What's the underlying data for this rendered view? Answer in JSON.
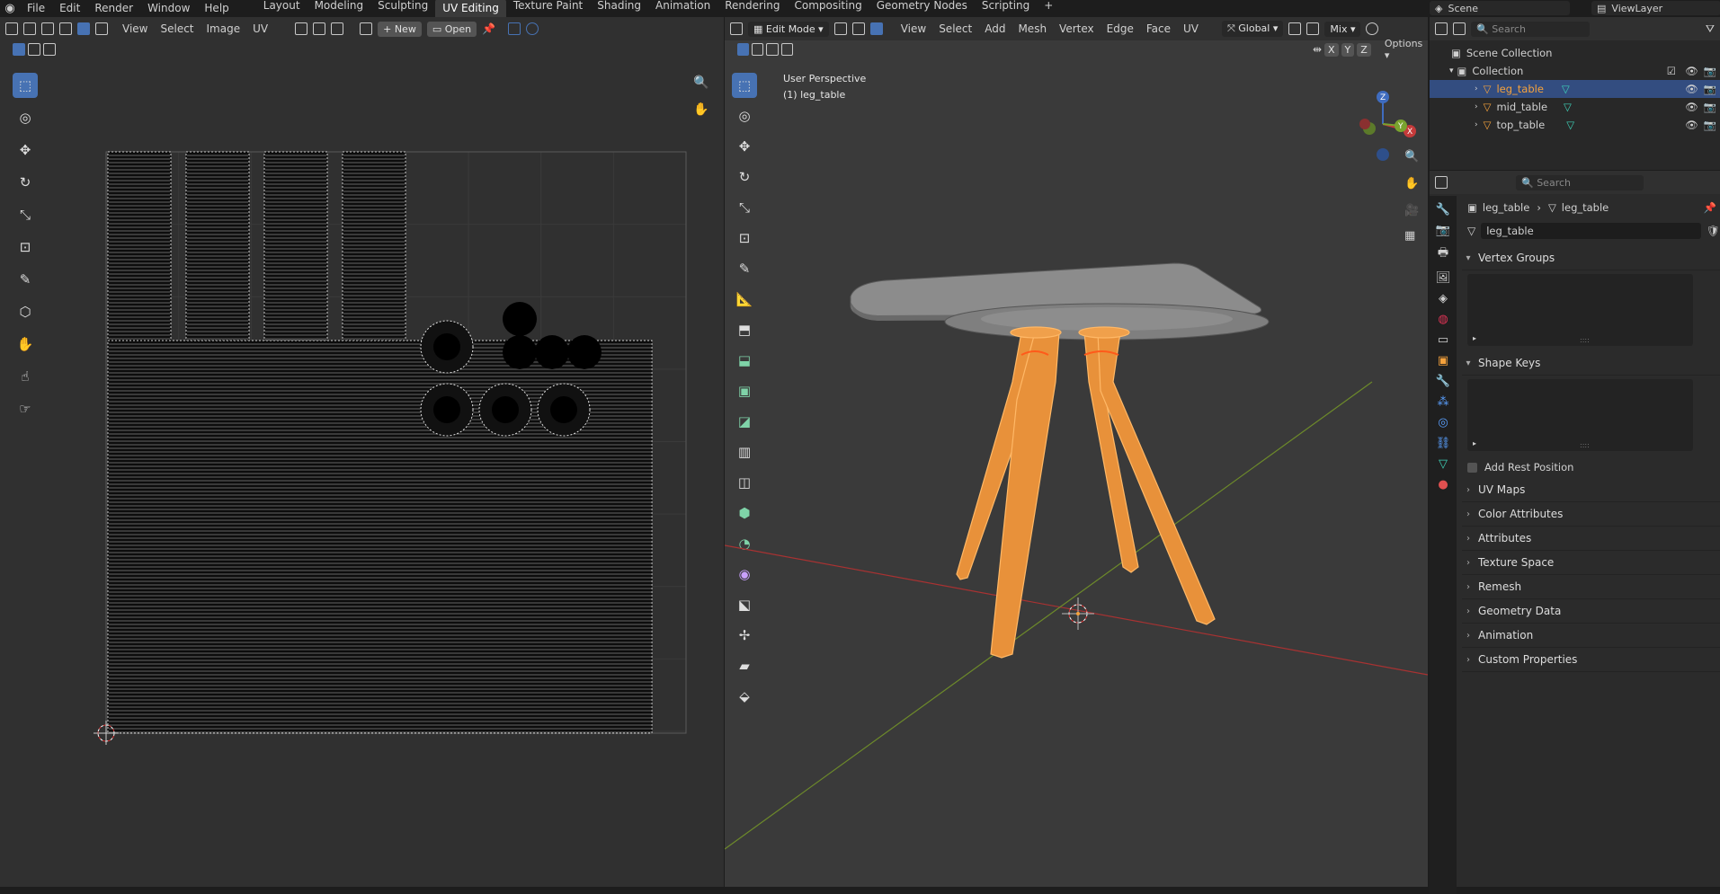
{
  "topbar": {
    "menu": [
      "File",
      "Edit",
      "Render",
      "Window",
      "Help"
    ],
    "workspaces": [
      "Layout",
      "Modeling",
      "Sculpting",
      "UV Editing",
      "Texture Paint",
      "Shading",
      "Animation",
      "Rendering",
      "Compositing",
      "Geometry Nodes",
      "Scripting"
    ],
    "active_workspace": "UV Editing",
    "scene": "Scene",
    "view_layer": "ViewLayer"
  },
  "uv_editor": {
    "menus": [
      "View",
      "Select",
      "Image",
      "UV"
    ],
    "new_label": "New",
    "open_label": "Open"
  },
  "viewport": {
    "mode": "Edit Mode",
    "menus": [
      "View",
      "Select",
      "Add",
      "Mesh",
      "Vertex",
      "Edge",
      "Face",
      "UV"
    ],
    "transform": "Global",
    "snap": "Mix",
    "options": "Options",
    "axes": [
      "X",
      "Y",
      "Z"
    ],
    "perspective": "User Perspective",
    "object_label": "(1) leg_table"
  },
  "outliner": {
    "search_placeholder": "Search",
    "scene_collection": "Scene Collection",
    "collection": "Collection",
    "objects": [
      "leg_table",
      "mid_table",
      "top_table"
    ],
    "active": "leg_table"
  },
  "properties": {
    "search_placeholder": "Search",
    "breadcrumb_obj": "leg_table",
    "breadcrumb_mesh": "leg_table",
    "mesh_name": "leg_table",
    "vertex_groups": "Vertex Groups",
    "shape_keys": "Shape Keys",
    "add_rest_position": "Add Rest Position",
    "collapsed_panels": [
      "UV Maps",
      "Color Attributes",
      "Attributes",
      "Texture Space",
      "Remesh",
      "Geometry Data",
      "Animation",
      "Custom Properties"
    ]
  },
  "colors": {
    "accent": "#4772b3",
    "selected_orange": "#f5a23c",
    "axis_x": "#c0392b",
    "axis_y": "#7aa32e"
  }
}
